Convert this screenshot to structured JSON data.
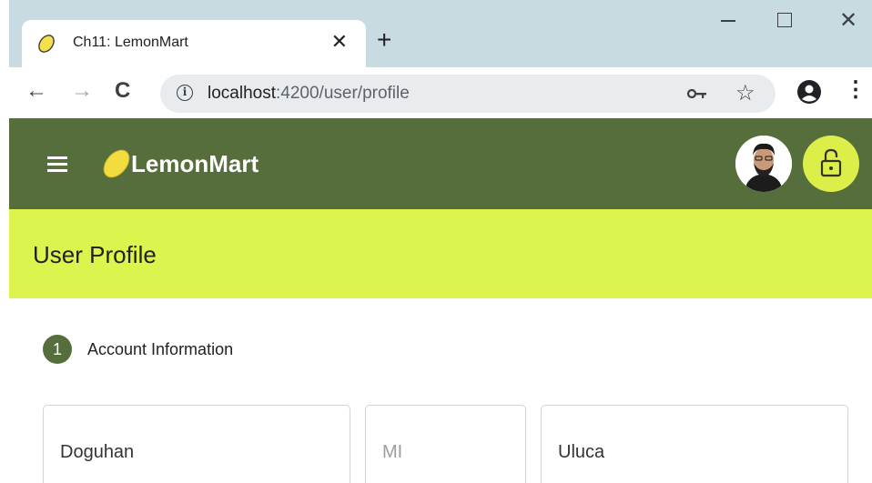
{
  "browser": {
    "tab_title": "Ch11: LemonMart",
    "tab_close": "✕",
    "new_tab": "+",
    "win_close": "✕",
    "url_host": "localhost",
    "url_rest": ":4200/user/profile",
    "info_symbol": "i",
    "star": "☆",
    "menu": "⋮",
    "back": "←",
    "forward": "→",
    "reload": "C"
  },
  "app": {
    "brand": "LemonMart",
    "page_title": "User Profile"
  },
  "stepper": {
    "step_number": "1",
    "step_label": "Account Information"
  },
  "form": {
    "first_name_value": "Doguhan",
    "middle_initial_placeholder": "MI",
    "last_name_value": "Uluca"
  },
  "colors": {
    "header_bg": "#556e3b",
    "title_band_bg": "#dcf44d",
    "accent": "#dcef48",
    "tab_strip": "#c7dbe0"
  },
  "icons": [
    "lemon-icon",
    "close-icon",
    "plus-icon",
    "minimize-icon",
    "maximize-icon",
    "back-arrow-icon",
    "forward-arrow-icon",
    "reload-icon",
    "info-icon",
    "key-icon",
    "star-icon",
    "account-icon",
    "menu-icon",
    "hamburger-icon",
    "avatar",
    "unlock-icon"
  ]
}
